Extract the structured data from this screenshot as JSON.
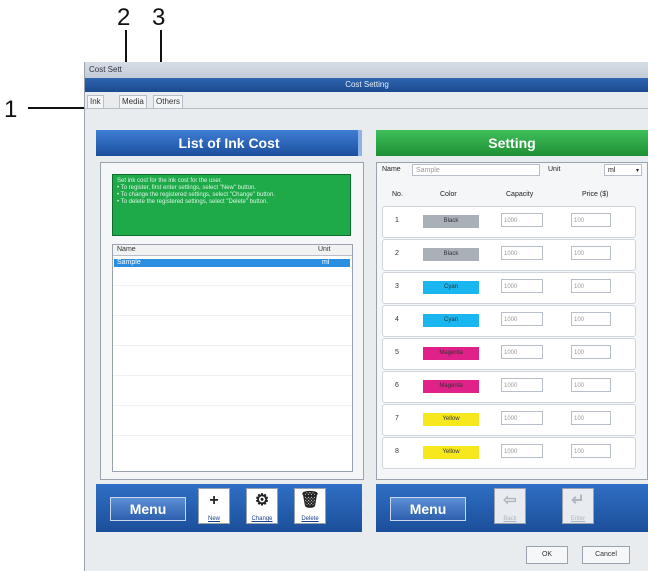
{
  "callouts": [
    "1",
    "2",
    "3"
  ],
  "window": {
    "title": "Cost Sett",
    "banner": "Cost Setting",
    "tabs": [
      "Ink",
      "Media",
      "Others"
    ]
  },
  "left_panel": {
    "header": "List of Ink Cost",
    "info_lines": [
      "Set ink cost for the ink cost for the user.",
      "• To register, first enter settings, select \"New\" button.",
      "• To change the registered settings, select \"Change\" button.",
      "• To delete the registered settings, select \"Delete\" button."
    ],
    "columns": [
      "Name",
      "Unit"
    ],
    "rows": [
      {
        "name": "Sample",
        "unit": "ml"
      }
    ]
  },
  "right_panel": {
    "header": "Setting",
    "name_label": "Name",
    "name_value": "Sample",
    "unit_label": "Unit",
    "unit_value": "ml",
    "columns": [
      "No.",
      "Color",
      "Capacity",
      "Price"
    ],
    "price_suffix": "($)",
    "rows": [
      {
        "no": "1",
        "color": "Black",
        "chip": "#a9b0b8",
        "capacity": "1000",
        "price": "100"
      },
      {
        "no": "2",
        "color": "Black",
        "chip": "#a9b0b8",
        "capacity": "1000",
        "price": "100"
      },
      {
        "no": "3",
        "color": "Cyan",
        "chip": "#19b6ef",
        "capacity": "1000",
        "price": "100"
      },
      {
        "no": "4",
        "color": "Cyan",
        "chip": "#19b6ef",
        "capacity": "1000",
        "price": "100"
      },
      {
        "no": "5",
        "color": "Magenta",
        "chip": "#e0218a",
        "capacity": "1000",
        "price": "100"
      },
      {
        "no": "6",
        "color": "Magenta",
        "chip": "#e0218a",
        "capacity": "1000",
        "price": "100"
      },
      {
        "no": "7",
        "color": "Yellow",
        "chip": "#f6e81c",
        "capacity": "1000",
        "price": "100"
      },
      {
        "no": "8",
        "color": "Yellow",
        "chip": "#f6e81c",
        "capacity": "1000",
        "price": "100"
      }
    ]
  },
  "left_bar": {
    "menu": "Menu",
    "buttons": [
      {
        "icon": "+",
        "label": "New"
      },
      {
        "icon": "⚙",
        "label": "Change"
      },
      {
        "icon": "🗑",
        "label": "Delete"
      }
    ]
  },
  "right_bar": {
    "menu": "Menu",
    "buttons": [
      {
        "icon": "⇦",
        "label": "Back"
      },
      {
        "icon": "↵",
        "label": "Enter"
      }
    ]
  },
  "footer": {
    "ok": "OK",
    "cancel": "Cancel"
  },
  "colors": {
    "accent_blue": "#1b4f9c",
    "accent_green": "#1f8f35",
    "info_green": "#1faa4a",
    "selection": "#2a8fe0"
  }
}
